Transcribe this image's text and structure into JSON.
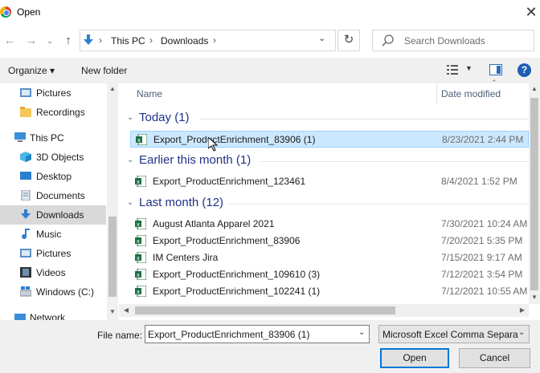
{
  "window": {
    "title": "Open"
  },
  "address": {
    "crumbs": [
      "This PC",
      "Downloads"
    ]
  },
  "search": {
    "placeholder": "Search Downloads"
  },
  "toolbar": {
    "organize": "Organize ▾",
    "new_folder": "New folder",
    "help": "?"
  },
  "sidebar": {
    "items": [
      {
        "label": "Pictures",
        "icon": "pictures-icon"
      },
      {
        "label": "Recordings",
        "icon": "folder-icon"
      },
      {
        "label": "This PC",
        "icon": "computer-icon"
      },
      {
        "label": "3D Objects",
        "icon": "3d-objects-icon"
      },
      {
        "label": "Desktop",
        "icon": "desktop-icon"
      },
      {
        "label": "Documents",
        "icon": "documents-icon"
      },
      {
        "label": "Downloads",
        "icon": "downloads-icon"
      },
      {
        "label": "Music",
        "icon": "music-icon"
      },
      {
        "label": "Pictures",
        "icon": "pictures-icon"
      },
      {
        "label": "Videos",
        "icon": "videos-icon"
      },
      {
        "label": "Windows (C:)",
        "icon": "drive-icon"
      },
      {
        "label": "Network",
        "icon": "network-icon"
      }
    ]
  },
  "columns": {
    "name": "Name",
    "date": "Date modified"
  },
  "groups": [
    {
      "label": "Today (1)",
      "files": [
        {
          "name": "Export_ProductEnrichment_83906 (1)",
          "date": "8/23/2021 2:44 PM",
          "selected": true
        }
      ]
    },
    {
      "label": "Earlier this month (1)",
      "files": [
        {
          "name": "Export_ProductEnrichment_123461",
          "date": "8/4/2021 1:52 PM"
        }
      ]
    },
    {
      "label": "Last month (12)",
      "files": [
        {
          "name": "August Atlanta Apparel 2021",
          "date": "7/30/2021 10:24 AM"
        },
        {
          "name": "Export_ProductEnrichment_83906",
          "date": "7/20/2021 5:35 PM"
        },
        {
          "name": "IM Centers Jira",
          "date": "7/15/2021 9:17 AM"
        },
        {
          "name": "Export_ProductEnrichment_109610 (3)",
          "date": "7/12/2021 3:54 PM"
        },
        {
          "name": "Export_ProductEnrichment_102241 (1)",
          "date": "7/12/2021 10:55 AM"
        }
      ]
    }
  ],
  "footer": {
    "file_name_label": "File name:",
    "file_name_value": "Export_ProductEnrichment_83906 (1)",
    "file_type": "Microsoft Excel Comma Separa",
    "open": "Open",
    "cancel": "Cancel"
  },
  "colors": {
    "accent": "#0078d7",
    "selection": "#cce8ff",
    "group_header": "#1e3287",
    "excel": "#1d6f42"
  }
}
